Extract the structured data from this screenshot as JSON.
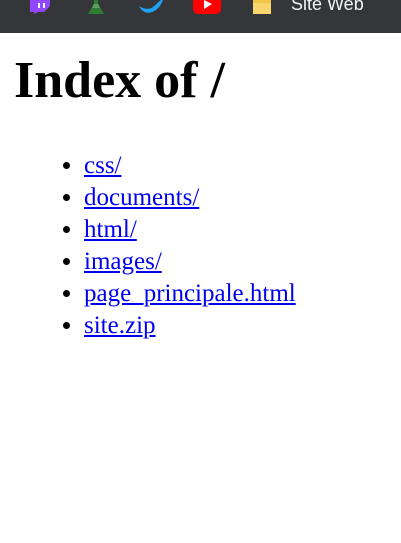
{
  "bookmarks_bar": {
    "items": [
      {
        "icon": "twitch-icon",
        "color": "#9146ff"
      },
      {
        "icon": "bottle-icon",
        "color": "#2f7d32"
      },
      {
        "icon": "twitter-icon",
        "color": "#1da1f2"
      },
      {
        "icon": "youtube-icon",
        "color": "#ff0000"
      }
    ],
    "folder": {
      "icon": "folder-icon",
      "label": "Site Web",
      "color": "#f9d56e"
    }
  },
  "page": {
    "title": "Index of /",
    "entries": [
      {
        "label": "css/"
      },
      {
        "label": "documents/"
      },
      {
        "label": "html/"
      },
      {
        "label": "images/"
      },
      {
        "label": "page_principale.html"
      },
      {
        "label": "site.zip"
      }
    ]
  },
  "colors": {
    "link": "#0000ee",
    "toolbar_bg": "#35363a",
    "page_bg": "#ffffff"
  }
}
